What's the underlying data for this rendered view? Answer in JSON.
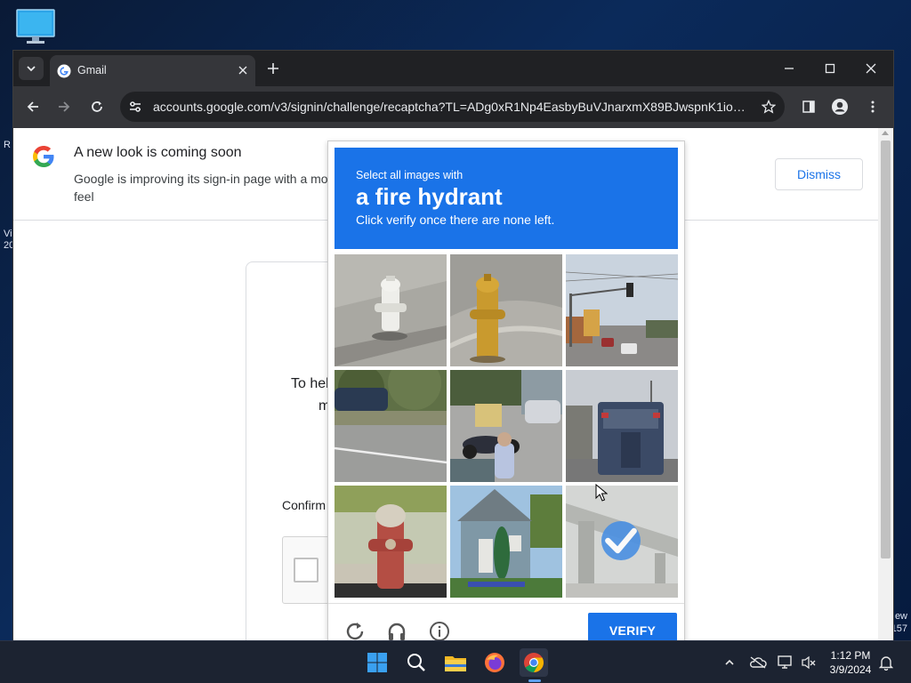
{
  "desktop": {
    "icon": "computer-monitor-icon",
    "left_fragments": [
      "R",
      "Vi",
      "20"
    ],
    "right_fragments": [
      "ew",
      "157"
    ]
  },
  "browser": {
    "tab": {
      "title": "Gmail",
      "favicon": "google-g-icon"
    },
    "omnibox": {
      "url": "accounts.google.com/v3/signin/challenge/recaptcha?TL=ADg0xR1Np4EasbyBuVJnarxmX89BJwspnK1ioo7..."
    }
  },
  "banner": {
    "title": "A new look is coming soon",
    "text_visible": "Google is improving its sign-in page with a mo",
    "text_line2": "feel",
    "dismiss_label": "Dismiss"
  },
  "signin": {
    "help_text": "To hel",
    "help_text2": "m",
    "confirm_text": "Confirm"
  },
  "challenge": {
    "line1": "Select all images with",
    "line2": "a fire hydrant",
    "line3": "Click verify once there are none left.",
    "verify_label": "VERIFY",
    "accent": "#1a73e8",
    "tiles": [
      {
        "subject": "white fire hydrant on sidewalk",
        "selected": false
      },
      {
        "subject": "yellow fire hydrant on sidewalk",
        "selected": false
      },
      {
        "subject": "street with traffic light",
        "selected": false
      },
      {
        "subject": "road with trees and parked car",
        "selected": false
      },
      {
        "subject": "street with motorcycles and person",
        "selected": false
      },
      {
        "subject": "garbage truck on street",
        "selected": false
      },
      {
        "subject": "red fire hydrant",
        "selected": false
      },
      {
        "subject": "house with lawn",
        "selected": false
      },
      {
        "subject": "elevated highway overpass",
        "selected": true
      }
    ]
  },
  "taskbar": {
    "apps": [
      "windows-start-icon",
      "search-icon",
      "file-explorer-icon",
      "firefox-icon",
      "chrome-icon"
    ],
    "time": "1:12 PM",
    "date": "3/9/2024"
  }
}
